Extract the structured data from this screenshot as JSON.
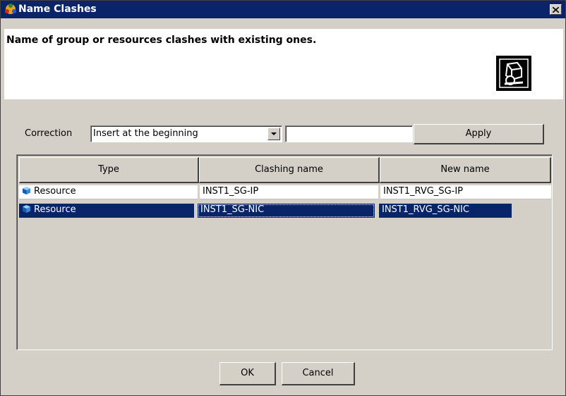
{
  "window": {
    "title": "Name Clashes",
    "title_bar_color": "#0a246a"
  },
  "header": {
    "message": "Name of group or resources clashes with existing ones."
  },
  "correction": {
    "label": "Correction",
    "selected_option": "Insert at the beginning",
    "text_value": "",
    "apply_label": "Apply"
  },
  "table": {
    "columns": [
      "Type",
      "Clashing name",
      "New name"
    ],
    "rows": [
      {
        "type": "Resource",
        "clashing_name": "INST1_SG-IP",
        "new_name": "INST1_RVG_SG-IP",
        "selected": false
      },
      {
        "type": "Resource",
        "clashing_name": "INST1_SG-NIC",
        "new_name": "INST1_RVG_SG-NIC",
        "selected": true
      }
    ]
  },
  "buttons": {
    "ok": "OK",
    "cancel": "Cancel"
  }
}
